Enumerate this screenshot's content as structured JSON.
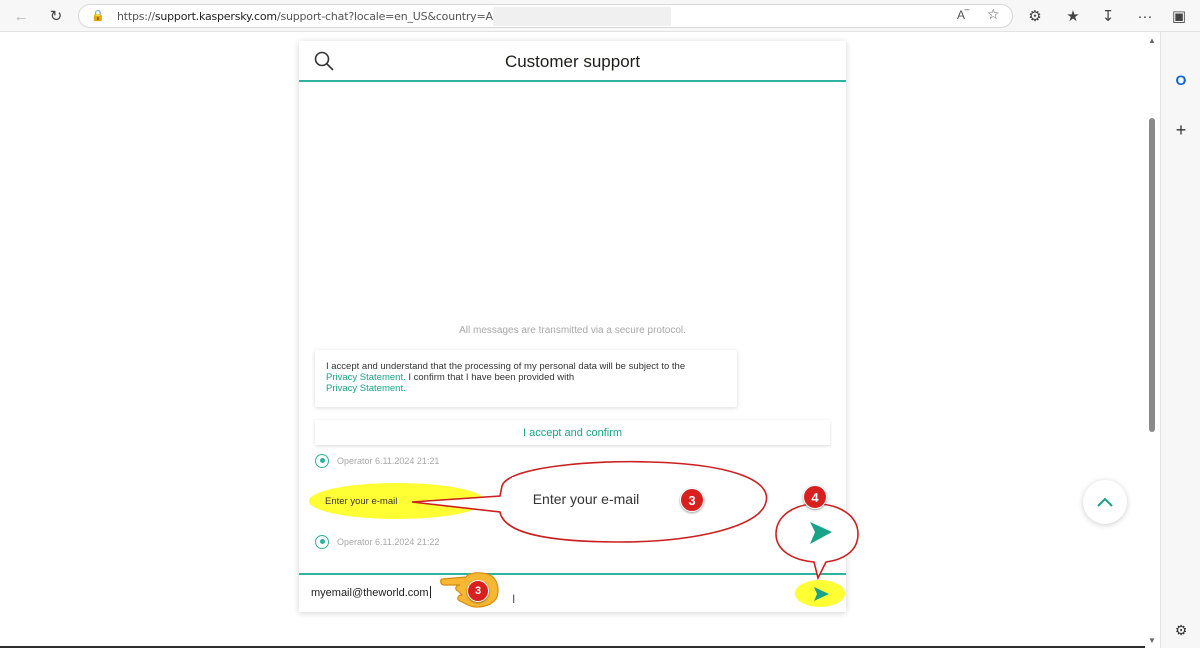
{
  "browser": {
    "url_prefix": "https://",
    "url_domain": "support.kaspersky.com",
    "url_rest": "/support-chat?locale=en_US&country=AU&inc="
  },
  "chat": {
    "title": "Customer support",
    "secure_notice": "All messages are transmitted via a secure protocol.",
    "consent": {
      "line1": "I accept and understand that the processing of my personal data will be subject to the",
      "link1": "Privacy Statement.",
      "line2": " I confirm that I have been provided with",
      "link2": "Privacy Statement."
    },
    "accept_label": "I accept and confirm",
    "operator1": "Operator 6.11.2024 21:21",
    "operator_message": "Enter your e-mail",
    "operator2": "Operator 6.11.2024 21:22",
    "input_value": "myemail@theworld.com"
  },
  "annotations": {
    "callout_text": "Enter your e-mail",
    "badge_callout": "3",
    "badge_hand": "3",
    "badge_send": "4",
    "highlight_color": "#ffff33",
    "badge_color": "#d8201f"
  },
  "colors": {
    "accent": "#2db39e",
    "link": "#1aa388"
  },
  "icons": {
    "search": "search-icon",
    "send": "send-icon",
    "scroll_up": "chevron-up-icon",
    "operator": "user-circle-icon"
  }
}
